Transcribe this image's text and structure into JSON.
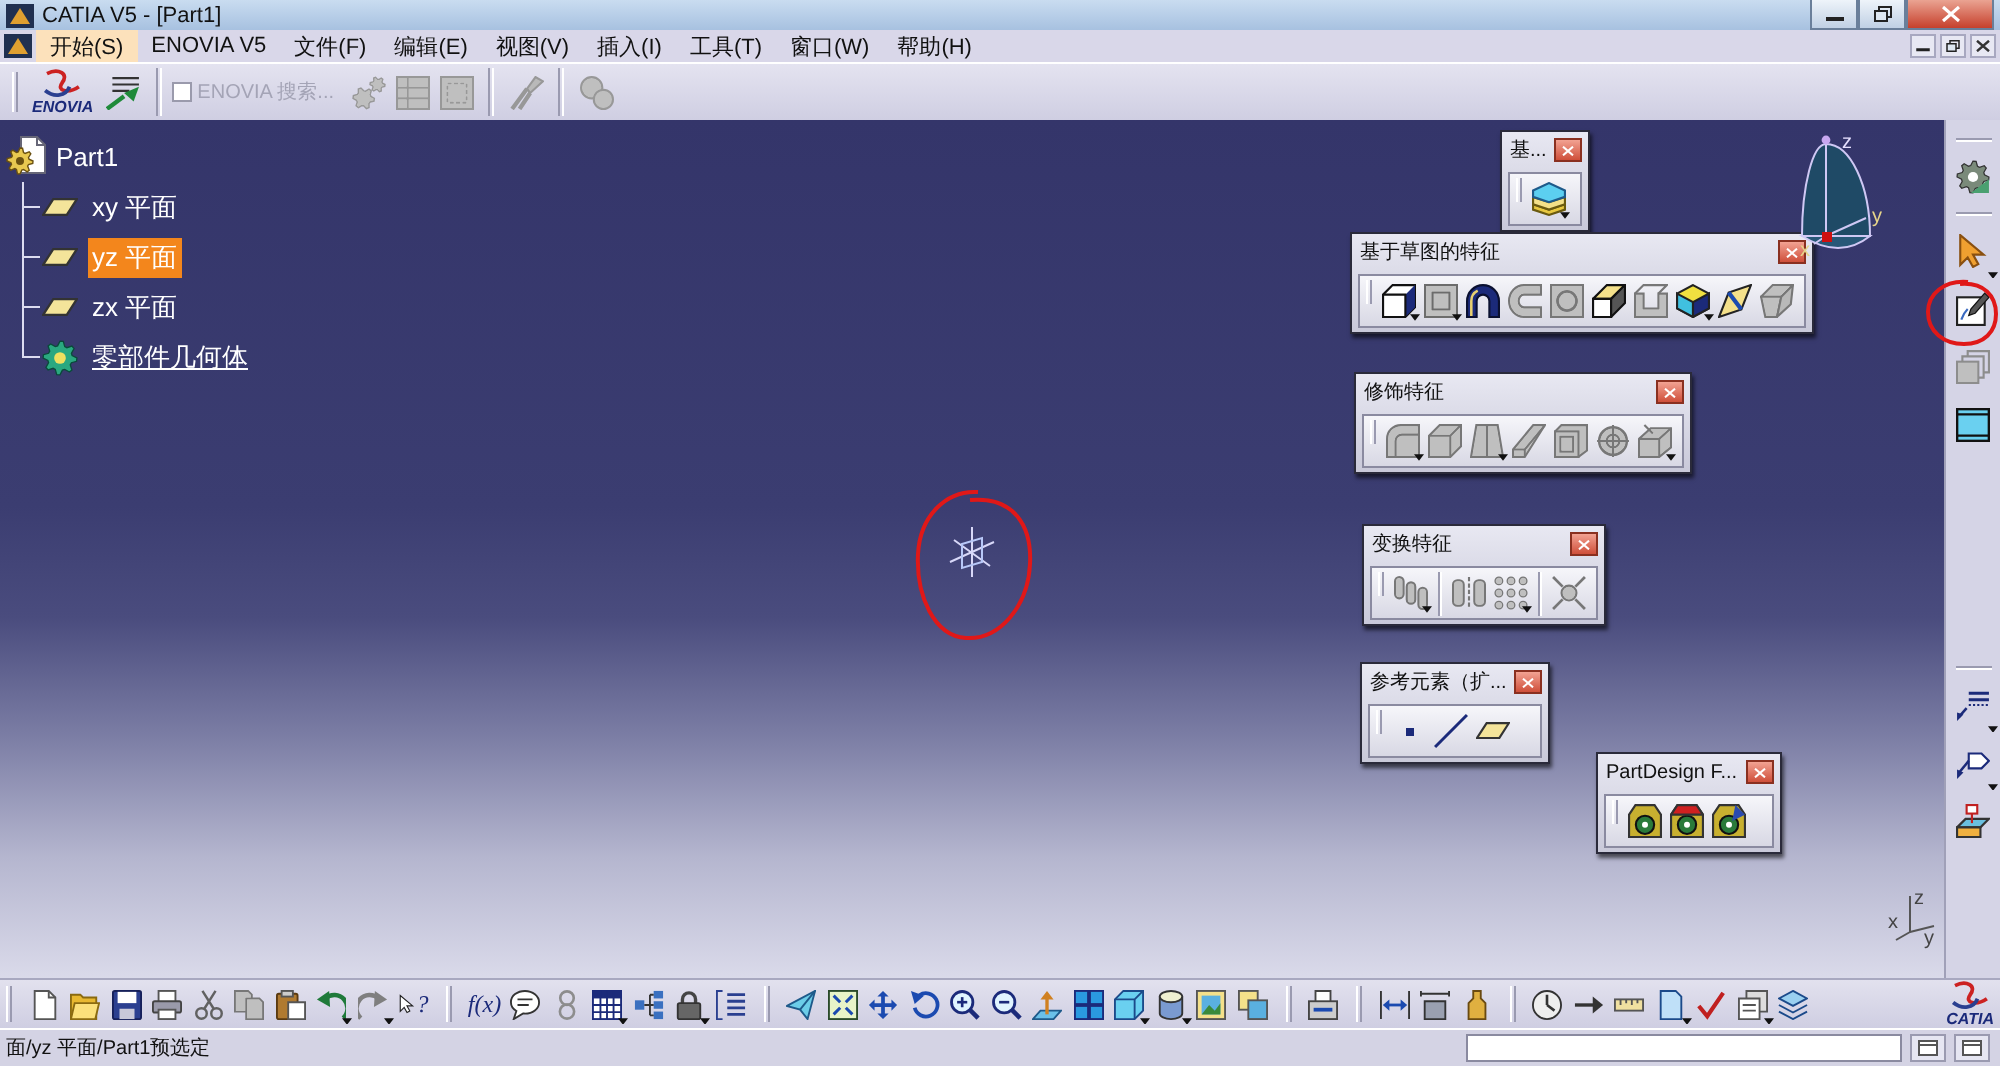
{
  "window": {
    "title": "CATIA V5 - [Part1]"
  },
  "menu_bar": {
    "items": [
      {
        "label": "开始(S)",
        "selected": true
      },
      {
        "label": "ENOVIA V5",
        "selected": false
      },
      {
        "label": "文件(F)",
        "selected": false
      },
      {
        "label": "编辑(E)",
        "selected": false
      },
      {
        "label": "视图(V)",
        "selected": false
      },
      {
        "label": "插入(I)",
        "selected": false
      },
      {
        "label": "工具(T)",
        "selected": false
      },
      {
        "label": "窗口(W)",
        "selected": false
      },
      {
        "label": "帮助(H)",
        "selected": false
      }
    ]
  },
  "top_toolbar": {
    "logo": "ENOVIA",
    "transfer_button": {
      "kind": "transfer",
      "disabled": false,
      "dropdown": false
    },
    "search_checkbox": {
      "label": "ENOVIA 搜索...",
      "checked": false,
      "disabled": true
    },
    "groups": [
      [
        {
          "kind": "gear_pair",
          "disabled": true,
          "dropdown": false
        },
        {
          "kind": "grid_page",
          "disabled": true,
          "dropdown": false
        },
        {
          "kind": "dashed_frame",
          "disabled": true,
          "dropdown": false
        }
      ],
      [
        {
          "kind": "pliers",
          "disabled": true,
          "dropdown": false
        }
      ],
      [
        {
          "kind": "linked_circles",
          "disabled": true,
          "dropdown": false
        }
      ]
    ]
  },
  "tree": [
    {
      "label": "Part1",
      "kind": "part",
      "selected": false,
      "in_work_object": false,
      "children": [
        {
          "label": "xy 平面",
          "kind": "plane",
          "selected": false,
          "in_work_object": false
        },
        {
          "label": "yz 平面",
          "kind": "plane",
          "selected": true,
          "in_work_object": false
        },
        {
          "label": "zx 平面",
          "kind": "plane",
          "selected": false,
          "in_work_object": false
        },
        {
          "label": "零部件几何体",
          "kind": "body",
          "selected": false,
          "in_work_object": true
        }
      ]
    }
  ],
  "compass": {
    "axes": [
      "z",
      "x",
      "y"
    ]
  },
  "floating_toolbars": [
    {
      "title": "基...",
      "groups": [
        [
          {
            "kind": "solid",
            "disabled": false,
            "dropdown": true
          }
        ]
      ]
    },
    {
      "title": "基于草图的特征",
      "groups": [
        [
          {
            "kind": "pad",
            "disabled": false,
            "dropdown": true
          },
          {
            "kind": "pocket",
            "disabled": true,
            "dropdown": true
          },
          {
            "kind": "shaft",
            "disabled": false,
            "dropdown": false
          },
          {
            "kind": "groove",
            "disabled": true,
            "dropdown": false
          },
          {
            "kind": "hole",
            "disabled": true,
            "dropdown": false
          },
          {
            "kind": "rib",
            "disabled": false,
            "dropdown": false
          },
          {
            "kind": "slot",
            "disabled": true,
            "dropdown": false
          },
          {
            "kind": "multi_section",
            "disabled": false,
            "dropdown": true
          },
          {
            "kind": "stiffener",
            "disabled": false,
            "dropdown": false
          },
          {
            "kind": "loft",
            "disabled": true,
            "dropdown": false
          }
        ]
      ]
    },
    {
      "title": "修饰特征",
      "groups": [
        [
          {
            "kind": "fillet",
            "disabled": true,
            "dropdown": true
          },
          {
            "kind": "chamfer",
            "disabled": true,
            "dropdown": false
          },
          {
            "kind": "draft",
            "disabled": true,
            "dropdown": true
          },
          {
            "kind": "shell",
            "disabled": true,
            "dropdown": false
          },
          {
            "kind": "thickness",
            "disabled": true,
            "dropdown": false
          },
          {
            "kind": "thread",
            "disabled": true,
            "dropdown": false
          },
          {
            "kind": "remove_face",
            "disabled": true,
            "dropdown": true
          }
        ]
      ]
    },
    {
      "title": "变换特征",
      "groups": [
        [
          {
            "kind": "translate",
            "disabled": true,
            "dropdown": true
          }
        ],
        [
          {
            "kind": "mirror",
            "disabled": true,
            "dropdown": false
          },
          {
            "kind": "pattern",
            "disabled": true,
            "dropdown": true
          }
        ],
        [
          {
            "kind": "scale",
            "disabled": true,
            "dropdown": false
          }
        ]
      ]
    },
    {
      "title": "参考元素（扩...",
      "groups": [
        [
          {
            "kind": "point",
            "disabled": false,
            "dropdown": false
          },
          {
            "kind": "line",
            "disabled": false,
            "dropdown": false
          },
          {
            "kind": "plane",
            "disabled": false,
            "dropdown": false
          }
        ]
      ]
    },
    {
      "title": "PartDesign F...",
      "groups": [
        [
          {
            "kind": "pd_a",
            "disabled": false,
            "dropdown": false
          },
          {
            "kind": "pd_b",
            "disabled": false,
            "dropdown": false
          },
          {
            "kind": "pd_c",
            "disabled": false,
            "dropdown": false
          }
        ]
      ]
    }
  ],
  "right_toolbar": {
    "groups": [
      [
        {
          "kind": "body_gear",
          "disabled": false,
          "dropdown": false
        }
      ],
      [
        {
          "kind": "select",
          "disabled": false,
          "dropdown": true
        },
        {
          "kind": "sketch",
          "disabled": false,
          "dropdown": false
        },
        {
          "kind": "stack_frames",
          "disabled": true,
          "dropdown": false
        },
        {
          "kind": "axis_frame",
          "disabled": false,
          "dropdown": false
        }
      ],
      [
        {
          "kind": "annotation",
          "disabled": false,
          "dropdown": true
        },
        {
          "kind": "flag",
          "disabled": false,
          "dropdown": true
        },
        {
          "kind": "drawing",
          "disabled": false,
          "dropdown": false
        }
      ]
    ]
  },
  "view_axes": {
    "axes": [
      "z",
      "x",
      "y"
    ]
  },
  "bottom_toolbar": {
    "logo": "CATIA",
    "groups": [
      [
        {
          "kind": "new",
          "disabled": false,
          "dropdown": false
        },
        {
          "kind": "open",
          "disabled": false,
          "dropdown": false
        },
        {
          "kind": "save",
          "disabled": false,
          "dropdown": false
        },
        {
          "kind": "print",
          "disabled": false,
          "dropdown": false
        },
        {
          "kind": "cut",
          "disabled": true,
          "dropdown": false
        },
        {
          "kind": "copy",
          "disabled": true,
          "dropdown": false
        },
        {
          "kind": "paste",
          "disabled": false,
          "dropdown": false
        },
        {
          "kind": "undo",
          "disabled": false,
          "dropdown": true
        },
        {
          "kind": "redo",
          "disabled": true,
          "dropdown": true
        },
        {
          "kind": "whats_this",
          "label": "?",
          "disabled": false,
          "dropdown": false
        }
      ],
      [
        {
          "kind": "formula",
          "label": "f(x)",
          "disabled": false,
          "dropdown": false
        },
        {
          "kind": "comment",
          "disabled": false,
          "dropdown": false
        },
        {
          "kind": "knowledge",
          "disabled": true,
          "dropdown": false
        },
        {
          "kind": "table",
          "disabled": false,
          "dropdown": true
        },
        {
          "kind": "tree_diagram",
          "disabled": false,
          "dropdown": false
        },
        {
          "kind": "lock",
          "disabled": false,
          "dropdown": true
        },
        {
          "kind": "list",
          "disabled": false,
          "dropdown": false
        }
      ],
      [
        {
          "kind": "fly",
          "disabled": false,
          "dropdown": false
        },
        {
          "kind": "fit_all",
          "disabled": false,
          "dropdown": false
        },
        {
          "kind": "pan",
          "disabled": false,
          "dropdown": false
        },
        {
          "kind": "rotate",
          "disabled": false,
          "dropdown": false
        },
        {
          "kind": "zoom_in",
          "disabled": false,
          "dropdown": false
        },
        {
          "kind": "zoom_out",
          "disabled": false,
          "dropdown": false
        },
        {
          "kind": "normal_view",
          "disabled": false,
          "dropdown": false
        },
        {
          "kind": "multi_view",
          "disabled": false,
          "dropdown": false
        },
        {
          "kind": "iso_view",
          "disabled": false,
          "dropdown": true
        },
        {
          "kind": "render",
          "disabled": false,
          "dropdown": true
        },
        {
          "kind": "hide_show",
          "disabled": false,
          "dropdown": false
        },
        {
          "kind": "swap",
          "disabled": false,
          "dropdown": false
        }
      ],
      [
        {
          "kind": "tray",
          "disabled": false,
          "dropdown": false
        }
      ],
      [
        {
          "kind": "measure_between",
          "disabled": false,
          "dropdown": false
        },
        {
          "kind": "measure_item",
          "disabled": false,
          "dropdown": false
        },
        {
          "kind": "mass",
          "disabled": false,
          "dropdown": false
        }
      ],
      [
        {
          "kind": "dial",
          "disabled": false,
          "dropdown": false
        },
        {
          "kind": "arrow_right",
          "disabled": false,
          "dropdown": false
        },
        {
          "kind": "ruler",
          "disabled": false,
          "dropdown": false
        },
        {
          "kind": "sheet",
          "disabled": false,
          "dropdown": true
        },
        {
          "kind": "check",
          "disabled": false,
          "dropdown": false
        },
        {
          "kind": "sheets",
          "disabled": false,
          "dropdown": true
        },
        {
          "kind": "stack",
          "disabled": false,
          "dropdown": false
        }
      ]
    ]
  },
  "status_bar": {
    "message": "面/yz 平面/Part1预选定"
  }
}
